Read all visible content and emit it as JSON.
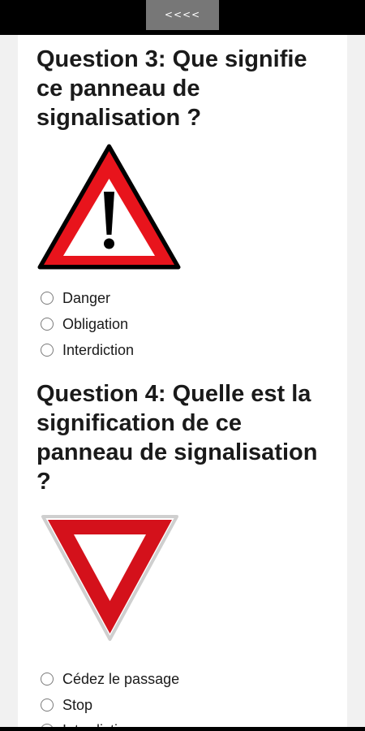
{
  "nav": {
    "back_label": "<<<<"
  },
  "questions": [
    {
      "title": "Question 3: Que signifie ce panneau de signalisation ?",
      "sign_icon": "danger-warning-triangle-icon",
      "options": [
        "Danger",
        "Obligation",
        "Interdiction"
      ]
    },
    {
      "title": "Question 4: Quelle est la signification de ce panneau de signalisation ?",
      "sign_icon": "yield-inverted-triangle-icon",
      "options": [
        "Cédez le passage",
        "Stop",
        "Interdiction"
      ]
    }
  ],
  "colors": {
    "sign_red": "#e8141c",
    "yield_red": "#d4111b",
    "topbar": "#000000",
    "back_button": "#777777"
  }
}
